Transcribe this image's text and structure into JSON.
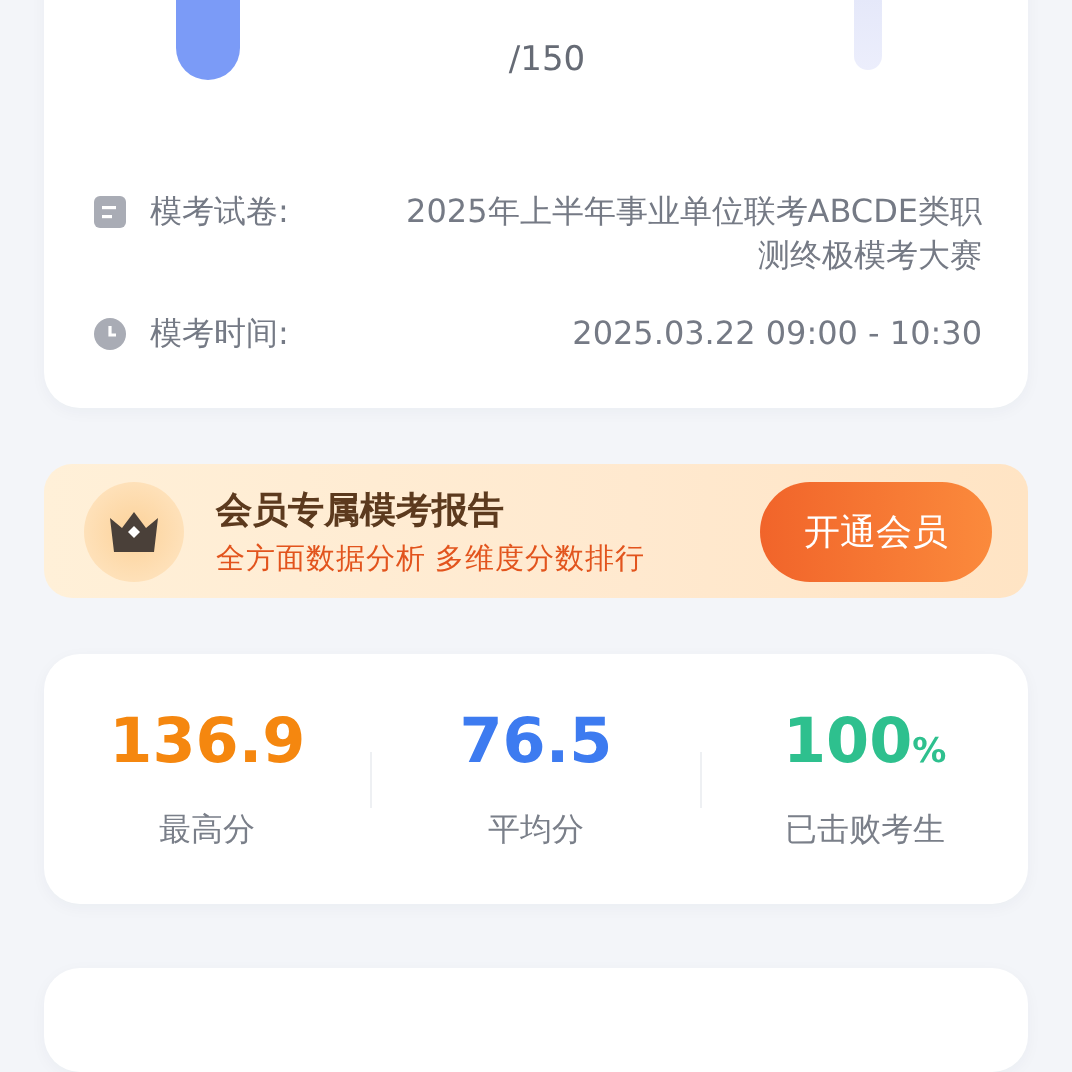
{
  "exam_card": {
    "score_total": "/150",
    "rows": [
      {
        "kind": "paper",
        "label": "模考试卷:",
        "value": "2025年上半年事业单位联考ABCDE类职测终极模考大赛"
      },
      {
        "kind": "time",
        "label": "模考时间:",
        "value": "2025.03.22 09:00 - 10:30"
      }
    ]
  },
  "vip_banner": {
    "title": "会员专属模考报告",
    "subtitle": "全方面数据分析 多维度分数排行",
    "button": "开通会员"
  },
  "stats": [
    {
      "value": "136.9",
      "label": "最高分",
      "color": "#f5870f"
    },
    {
      "value": "76.5",
      "label": "平均分",
      "color": "#3d7bf0"
    },
    {
      "value": "100",
      "unit": "%",
      "label": "已击败考生",
      "color": "#2ec08e"
    }
  ]
}
